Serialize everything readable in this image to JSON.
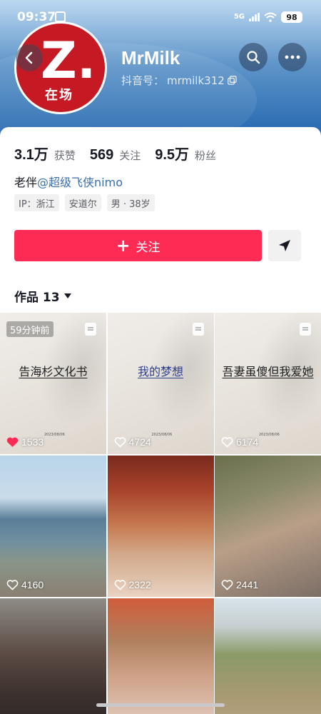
{
  "status_bar": {
    "time": "09:37",
    "network": "5G",
    "battery": "98"
  },
  "profile": {
    "avatar": {
      "letter": "Z.",
      "sub_text": "在场"
    },
    "username": "MrMilk",
    "douyin_id_label": "抖音号：",
    "douyin_id": "mrmilk312"
  },
  "stats": [
    {
      "value": "3.1万",
      "label": "获赞"
    },
    {
      "value": "569",
      "label": "关注"
    },
    {
      "value": "9.5万",
      "label": "粉丝"
    }
  ],
  "bio": {
    "prefix": "老伴",
    "mention": "@超级飞侠nimo"
  },
  "tags": [
    "IP：浙江",
    "安道尔",
    "男 · 38岁"
  ],
  "actions": {
    "follow_label": "关注"
  },
  "works_tab": {
    "label": "作品 13"
  },
  "videos": [
    {
      "title": "告海杉文化书",
      "date": "2023/08/06",
      "likes": "1533",
      "badge": "59分钟前"
    },
    {
      "title": "我的梦想",
      "date": "2023/08/06",
      "likes": "4724"
    },
    {
      "title": "吾妻虽傻但我爱她",
      "date": "2023/08/06",
      "likes": "6174"
    },
    {
      "likes": "4160"
    },
    {
      "likes": "2322"
    },
    {
      "likes": "2441"
    },
    {},
    {},
    {}
  ],
  "colors": {
    "accent": "#fe2c55",
    "mention": "#3a6ea8"
  }
}
